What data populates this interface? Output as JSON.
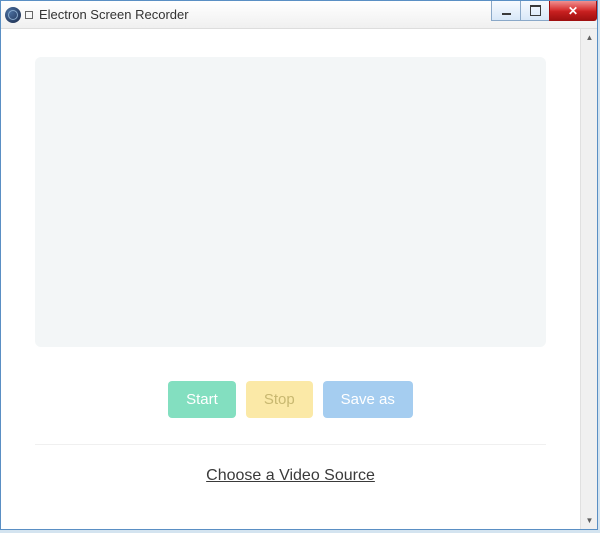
{
  "window": {
    "title": "Electron Screen Recorder"
  },
  "buttons": {
    "start": "Start",
    "stop": "Stop",
    "saveas": "Save as"
  },
  "source": {
    "choose_label": "Choose a Video Source"
  }
}
